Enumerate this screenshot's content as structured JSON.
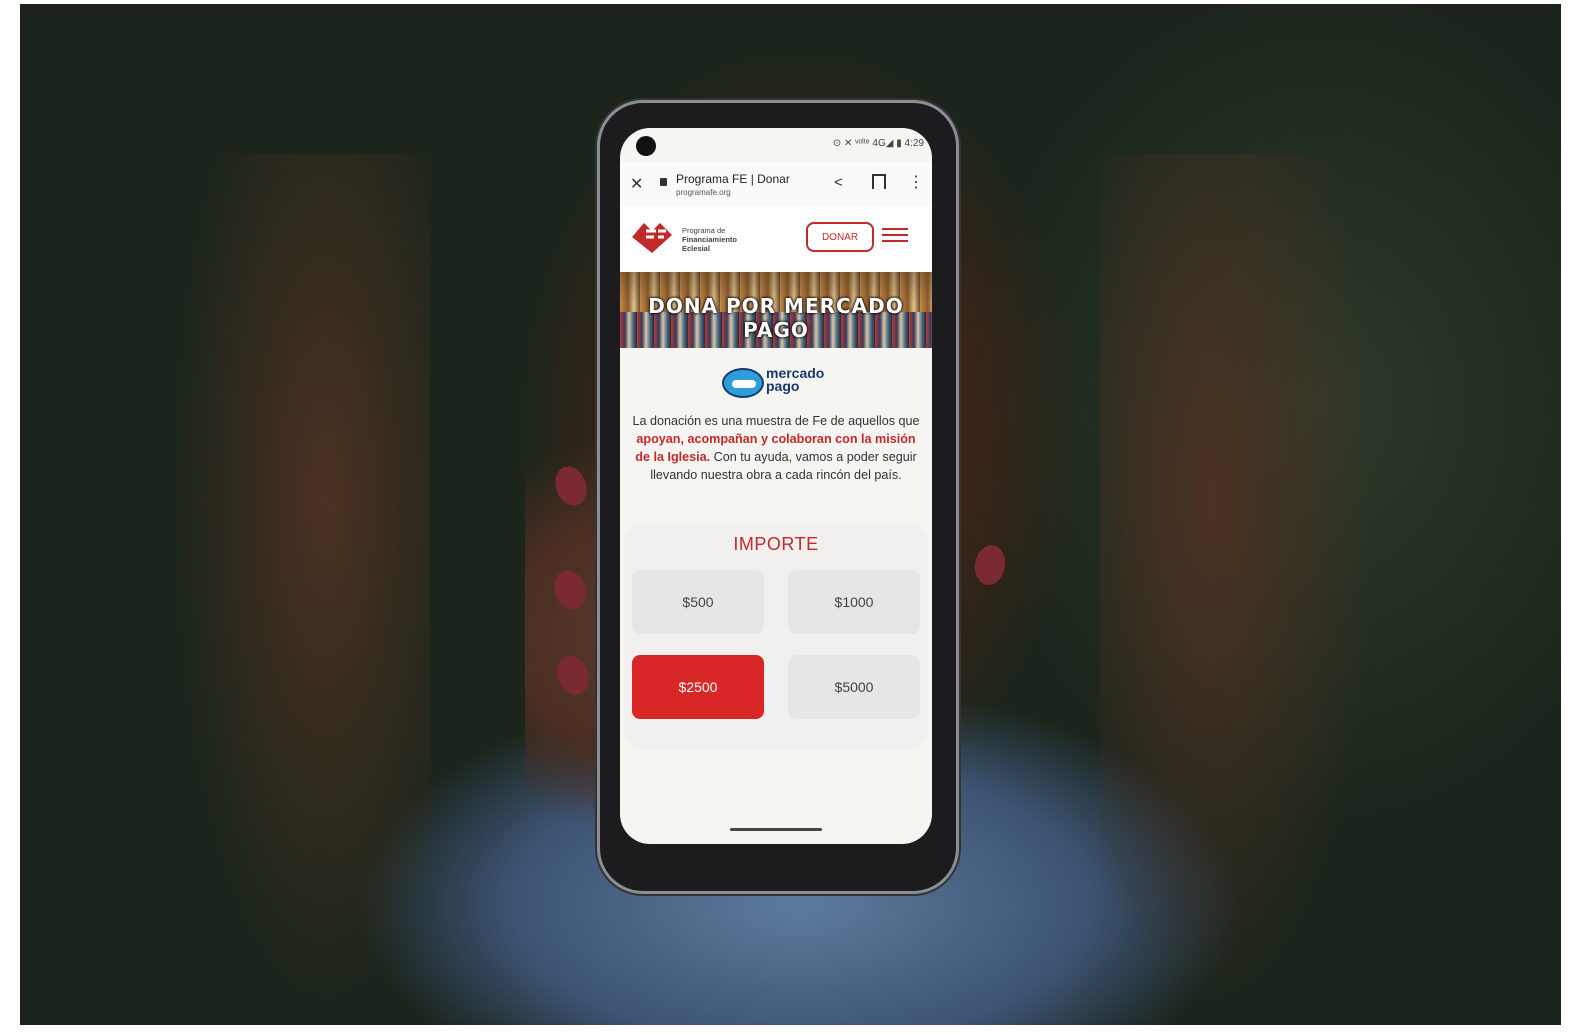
{
  "statusbar": {
    "icons_text": "⊙ ✕ ᵛᵒˡᵗᵉ 4G◢ ▮",
    "time": "4:29"
  },
  "browser": {
    "tab_title": "Programa FE | Donar",
    "host": "programafe.org"
  },
  "site": {
    "logo_lines": [
      "Programa de",
      "Financiamiento",
      "Eclesial"
    ],
    "donate_button": "DONAR"
  },
  "banner": {
    "title": "DONA POR MERCADO PAGO"
  },
  "mercado_pago": {
    "line1": "mercado",
    "line2": "pago"
  },
  "intro": {
    "part1": "La donación es una muestra de Fe de aquellos que ",
    "bold": "apoyan, acompañan y colaboran con la misión de la Iglesia.",
    "part2": " Con tu ayuda, vamos a poder seguir llevando nuestra obra a cada rincón del país."
  },
  "importe": {
    "title": "IMPORTE",
    "options": [
      "$500",
      "$1000",
      "$2500",
      "$5000"
    ],
    "selected": "$2500"
  },
  "colors": {
    "brand_red": "#c22a2a",
    "selected_red": "#d92626",
    "mp_blue": "#173b6c"
  }
}
